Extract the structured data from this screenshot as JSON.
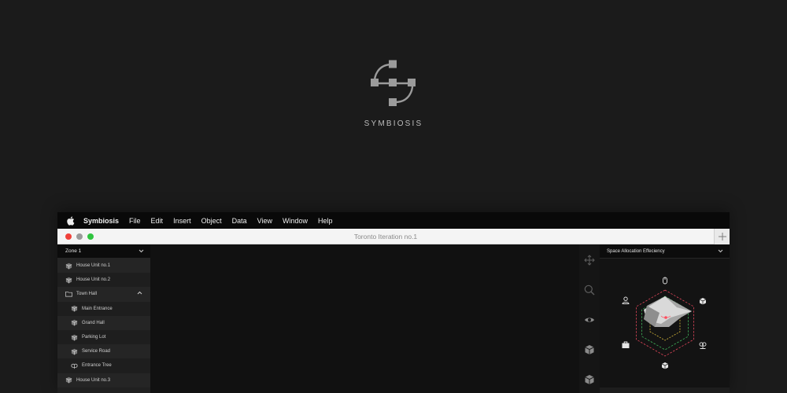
{
  "brand": {
    "name": "SYMBIOSIS",
    "logo_icon": "symbiosis-logo-icon"
  },
  "menubar": {
    "items": [
      "Symbiosis",
      "File",
      "Edit",
      "Insert",
      "Object",
      "Data",
      "View",
      "Window",
      "Help"
    ]
  },
  "window": {
    "title": "Toronto Iteration no.1"
  },
  "left_panel": {
    "zone": "Zone 1",
    "items": [
      {
        "label": "House Unit no.1",
        "icon": "cube-icon",
        "level": 1
      },
      {
        "label": "House Unit no.2",
        "icon": "cube-icon",
        "level": 1
      },
      {
        "label": "Town Hall",
        "icon": "folder-icon",
        "level": 1,
        "expanded": true
      },
      {
        "label": "Main Entrance",
        "icon": "cube-icon",
        "level": 2
      },
      {
        "label": "Grand Hall",
        "icon": "cube-icon",
        "level": 2
      },
      {
        "label": "Parking Lot",
        "icon": "cube-icon",
        "level": 2
      },
      {
        "label": "Service Road",
        "icon": "cube-icon",
        "level": 2
      },
      {
        "label": "Entrance Tree",
        "icon": "tree-icon",
        "level": 2
      },
      {
        "label": "House Unit no.3",
        "icon": "cube-icon",
        "level": 1
      }
    ]
  },
  "tools": [
    "move-icon",
    "search-icon",
    "eye-icon",
    "cube-icon",
    "cube-icon"
  ],
  "right_panel": {
    "metric": "Space Allocation Effeciency",
    "radar_axes": [
      "mouse-icon",
      "cube-icon",
      "tree-icon",
      "cube-icon",
      "briefcase-icon",
      "user-icon"
    ],
    "colors": {
      "outer_ring": "#e0465a",
      "middle_ring": "#3fb35a",
      "inner_ring": "#d8b93a",
      "accent": "#ff4d5e"
    }
  }
}
